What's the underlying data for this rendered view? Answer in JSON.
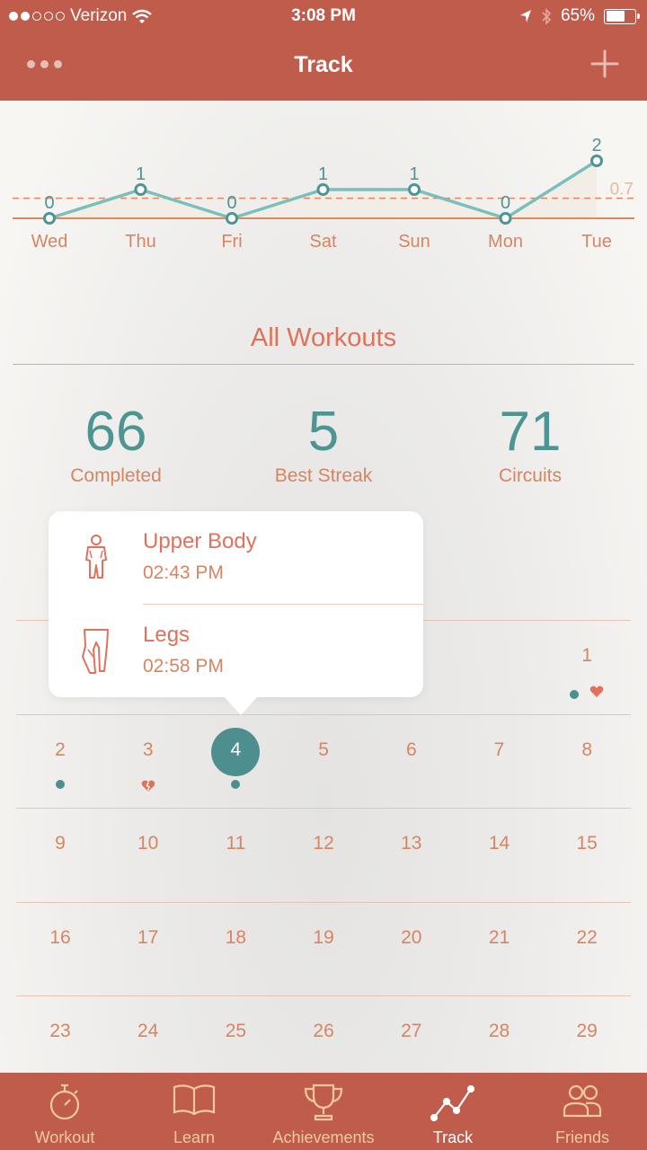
{
  "status_bar": {
    "carrier": "Verizon",
    "time": "3:08 PM",
    "battery": "65%",
    "battery_level": 0.65
  },
  "nav": {
    "title": "Track",
    "left_icon": "more-dots-icon",
    "right_icon": "plus-icon"
  },
  "chart_data": {
    "type": "line",
    "categories": [
      "Wed",
      "Thu",
      "Fri",
      "Sat",
      "Sun",
      "Mon",
      "Tue"
    ],
    "values": [
      0,
      1,
      0,
      1,
      1,
      0,
      2
    ],
    "data_labels": [
      "0",
      "1",
      "0",
      "1",
      "1",
      "0",
      "2"
    ],
    "average": 0.7,
    "average_label": "0.7",
    "ylim": [
      0,
      2
    ],
    "colors": {
      "line": "#7bbfbb",
      "axis": "#e0875f",
      "average": "#e0875f",
      "fill": "#f3ede7"
    }
  },
  "summary": {
    "title": "All Workouts",
    "stats": [
      {
        "value": "66",
        "label": "Completed"
      },
      {
        "value": "5",
        "label": "Best Streak"
      },
      {
        "value": "71",
        "label": "Circuits"
      }
    ]
  },
  "popover": {
    "items": [
      {
        "name": "Upper Body",
        "time": "02:43 PM",
        "icon": "upper-body-icon"
      },
      {
        "name": "Legs",
        "time": "02:58 PM",
        "icon": "legs-icon"
      }
    ]
  },
  "calendar": {
    "selected": "4",
    "weeks": [
      [
        {
          "day": "",
          "marks": []
        },
        {
          "day": "",
          "marks": []
        },
        {
          "day": "",
          "marks": []
        },
        {
          "day": "",
          "marks": []
        },
        {
          "day": "",
          "marks": []
        },
        {
          "day": "",
          "marks": []
        },
        {
          "day": "1",
          "marks": [
            "dot",
            "heart"
          ]
        }
      ],
      [
        {
          "day": "2",
          "marks": [
            "dot"
          ]
        },
        {
          "day": "3",
          "marks": [
            "broken-heart"
          ]
        },
        {
          "day": "4",
          "marks": [
            "dot"
          ]
        },
        {
          "day": "5",
          "marks": []
        },
        {
          "day": "6",
          "marks": []
        },
        {
          "day": "7",
          "marks": []
        },
        {
          "day": "8",
          "marks": []
        }
      ],
      [
        {
          "day": "9",
          "marks": []
        },
        {
          "day": "10",
          "marks": []
        },
        {
          "day": "11",
          "marks": []
        },
        {
          "day": "12",
          "marks": []
        },
        {
          "day": "13",
          "marks": []
        },
        {
          "day": "14",
          "marks": []
        },
        {
          "day": "15",
          "marks": []
        }
      ],
      [
        {
          "day": "16",
          "marks": []
        },
        {
          "day": "17",
          "marks": []
        },
        {
          "day": "18",
          "marks": []
        },
        {
          "day": "19",
          "marks": []
        },
        {
          "day": "20",
          "marks": []
        },
        {
          "day": "21",
          "marks": []
        },
        {
          "day": "22",
          "marks": []
        }
      ],
      [
        {
          "day": "23",
          "marks": []
        },
        {
          "day": "24",
          "marks": []
        },
        {
          "day": "25",
          "marks": []
        },
        {
          "day": "26",
          "marks": []
        },
        {
          "day": "27",
          "marks": []
        },
        {
          "day": "28",
          "marks": []
        },
        {
          "day": "29",
          "marks": []
        }
      ]
    ]
  },
  "tabs": [
    {
      "label": "Workout",
      "icon": "stopwatch-icon",
      "active": false
    },
    {
      "label": "Learn",
      "icon": "book-icon",
      "active": false
    },
    {
      "label": "Achievements",
      "icon": "trophy-icon",
      "active": false
    },
    {
      "label": "Track",
      "icon": "chart-line-icon",
      "active": true
    },
    {
      "label": "Friends",
      "icon": "friends-icon",
      "active": false
    }
  ]
}
